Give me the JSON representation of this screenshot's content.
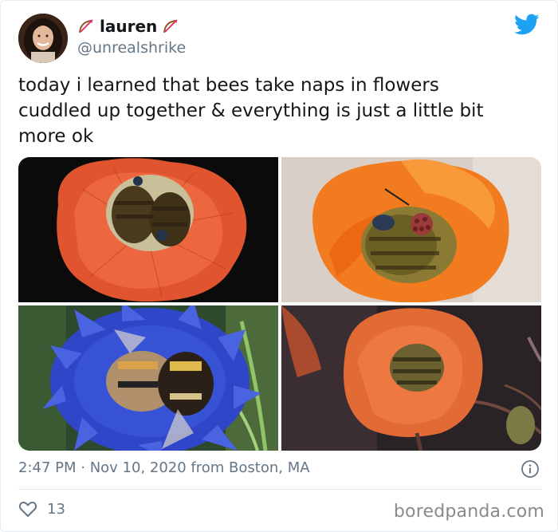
{
  "user": {
    "display_name": "lauren",
    "handle": "@unrealshrike"
  },
  "tweet": {
    "text": "today i learned that bees take naps in flowers\ncuddled up together & everything is just a little bit\nmore ok"
  },
  "meta": {
    "timestamp_line": "2:47 PM · Nov 10, 2020 from Boston, MA"
  },
  "engagement": {
    "likes": "13"
  },
  "watermark": "boredpanda.com",
  "icons": {
    "twitter": "twitter-bird-icon",
    "bow": "bow-and-arrow-icon",
    "info": "info-icon",
    "heart": "heart-icon"
  },
  "colors": {
    "twitter_blue": "#1da1f2",
    "text": "#14171a",
    "muted": "#657786",
    "bow_red": "#e0245e"
  }
}
